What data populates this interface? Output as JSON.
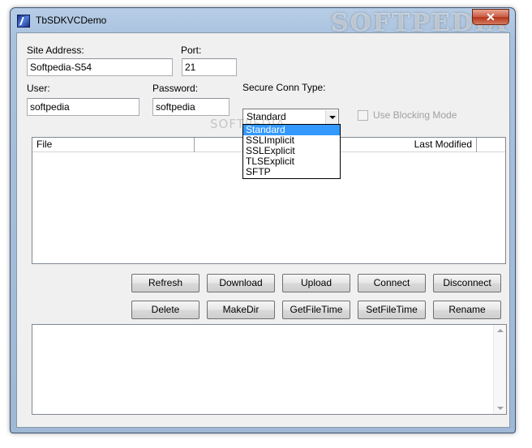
{
  "window": {
    "title": "TbSDKVCDemo",
    "close_glyph": "✕",
    "watermark": "SOFTPEDIA"
  },
  "form": {
    "site_label": "Site Address:",
    "site_value": "Softpedia-S54",
    "port_label": "Port:",
    "port_value": "21",
    "user_label": "User:",
    "user_value": "softpedia",
    "password_label": "Password:",
    "password_value": "softpedia",
    "secure_label": "Secure Conn Type:",
    "secure_value": "Standard",
    "secure_options": [
      "Standard",
      "SSLImplicit",
      "SSLExplicit",
      "TLSExplicit",
      "SFTP"
    ],
    "blocking_label": "Use Blocking Mode"
  },
  "list": {
    "col_file": "File",
    "col_modified": "Last Modified"
  },
  "buttons": {
    "refresh": "Refresh",
    "download": "Download",
    "upload": "Upload",
    "connect": "Connect",
    "disconnect": "Disconnect",
    "delete": "Delete",
    "makedir": "MakeDir",
    "getfiletime": "GetFileTime",
    "setfiletime": "SetFileTime",
    "rename": "Rename"
  },
  "watermark_center": "SOFTPEDIA",
  "icons": {
    "app": "app-icon",
    "close": "close-icon",
    "dropdown": "chevron-down-icon"
  }
}
